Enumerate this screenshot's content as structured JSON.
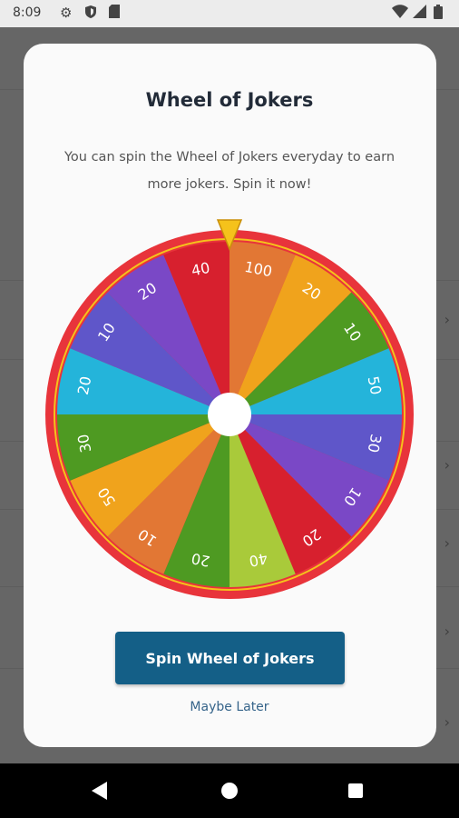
{
  "status_bar": {
    "time": "8:09",
    "icons": [
      "settings-icon",
      "shield-icon",
      "sim-card-icon",
      "wifi-icon",
      "signal-icon",
      "battery-icon"
    ]
  },
  "dialog": {
    "title": "Wheel of Jokers",
    "message": "You can spin the Wheel of Jokers everyday to earn more jokers. Spin it now!",
    "spin_button_label": "Spin Wheel of Jokers",
    "maybe_later_label": "Maybe Later"
  },
  "wheel": {
    "segments": [
      {
        "label": "100",
        "color": "#E27734"
      },
      {
        "label": "20",
        "color": "#F0A31C"
      },
      {
        "label": "10",
        "color": "#4E9A22"
      },
      {
        "label": "50",
        "color": "#24B4DA"
      },
      {
        "label": "30",
        "color": "#5F56C9"
      },
      {
        "label": "10",
        "color": "#7A48C6"
      },
      {
        "label": "20",
        "color": "#D7202E"
      },
      {
        "label": "40",
        "color": "#A9CA3A"
      },
      {
        "label": "20",
        "color": "#4E9A22"
      },
      {
        "label": "10",
        "color": "#E27734"
      },
      {
        "label": "50",
        "color": "#F0A31C"
      },
      {
        "label": "30",
        "color": "#4E9A22"
      },
      {
        "label": "20",
        "color": "#24B4DA"
      },
      {
        "label": "10",
        "color": "#5F56C9"
      },
      {
        "label": "20",
        "color": "#7A48C6"
      },
      {
        "label": "40",
        "color": "#D7202E"
      }
    ],
    "rim_color": "#E8343B",
    "rim_accent_color": "#F5C21B",
    "pointer_color": "#F5C21B",
    "hub_color": "#FFFFFF"
  },
  "colors": {
    "primary": "#145F87",
    "link": "#36648A",
    "title": "#222B38"
  }
}
